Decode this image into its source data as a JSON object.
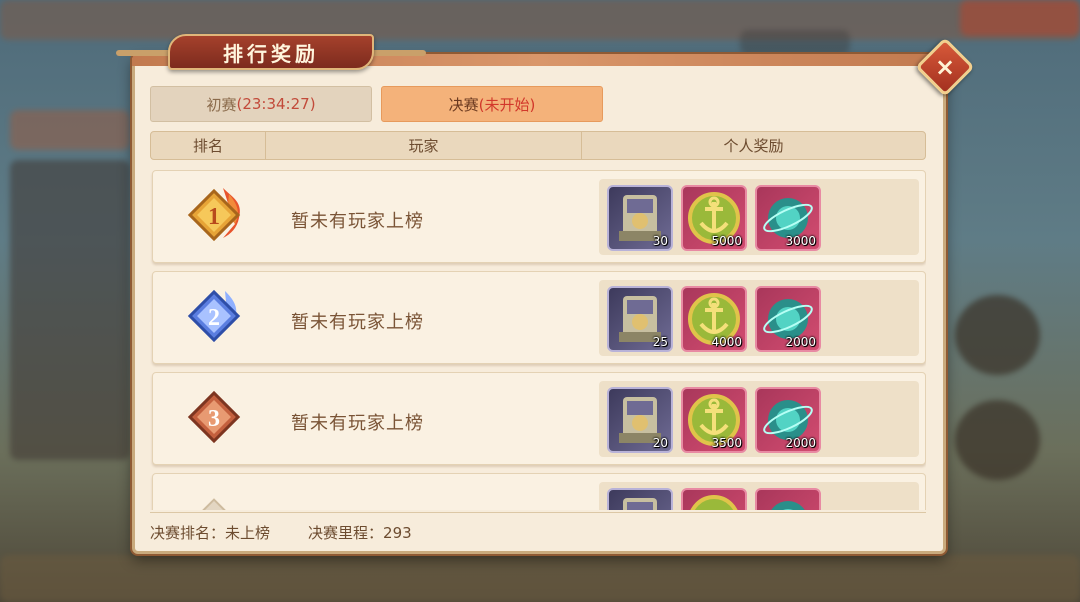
{
  "title": "排行奖励",
  "close_label": "×",
  "tabs": [
    {
      "label": "初赛",
      "status": "(23:34:27)",
      "active": false
    },
    {
      "label": "决赛",
      "status": "(未开始)",
      "active": true
    }
  ],
  "columns": [
    "排名",
    "玩家",
    "个人奖励"
  ],
  "rows": [
    {
      "rank": "1",
      "player": "暂未有玩家上榜",
      "rewards": [
        {
          "icon": "mecha-chest-icon",
          "qty": "30"
        },
        {
          "icon": "anchor-coin-icon",
          "qty": "5000"
        },
        {
          "icon": "teal-orb-icon",
          "qty": "3000"
        }
      ]
    },
    {
      "rank": "2",
      "player": "暂未有玩家上榜",
      "rewards": [
        {
          "icon": "mecha-chest-icon",
          "qty": "25"
        },
        {
          "icon": "anchor-coin-icon",
          "qty": "4000"
        },
        {
          "icon": "teal-orb-icon",
          "qty": "2000"
        }
      ]
    },
    {
      "rank": "3",
      "player": "暂未有玩家上榜",
      "rewards": [
        {
          "icon": "mecha-chest-icon",
          "qty": "20"
        },
        {
          "icon": "anchor-coin-icon",
          "qty": "3500"
        },
        {
          "icon": "teal-orb-icon",
          "qty": "2000"
        }
      ]
    },
    {
      "rank": "",
      "player": "",
      "rewards": [
        {
          "icon": "mecha-chest-icon",
          "qty": ""
        },
        {
          "icon": "anchor-coin-icon",
          "qty": ""
        },
        {
          "icon": "teal-orb-icon",
          "qty": ""
        }
      ]
    }
  ],
  "footer": {
    "final_rank_label": "决赛排名：",
    "final_rank_value": "未上榜",
    "final_mileage_label": "决赛里程：",
    "final_mileage_value": "293"
  },
  "colors": {
    "gold_badge": "#e7a437",
    "blue_badge": "#5b7ee0",
    "bronze_badge": "#c4603e",
    "active_tab": "#f4b27a",
    "status_red": "#d2382b"
  }
}
